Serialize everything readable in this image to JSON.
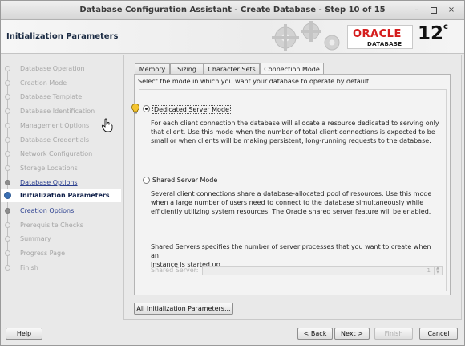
{
  "window": {
    "title": "Database Configuration Assistant - Create Database - Step 10 of 15",
    "minimize": "–",
    "close": "×"
  },
  "header": {
    "heading": "Initialization Parameters",
    "brand": "ORACLE",
    "brand_sub": "DATABASE",
    "version": "12",
    "version_sup": "c"
  },
  "steps": [
    {
      "label": "Database Operation",
      "state": "disabled"
    },
    {
      "label": "Creation Mode",
      "state": "disabled"
    },
    {
      "label": "Database Template",
      "state": "disabled"
    },
    {
      "label": "Database Identification",
      "state": "disabled"
    },
    {
      "label": "Management Options",
      "state": "disabled"
    },
    {
      "label": "Database Credentials",
      "state": "disabled"
    },
    {
      "label": "Network Configuration",
      "state": "disabled"
    },
    {
      "label": "Storage Locations",
      "state": "disabled"
    },
    {
      "label": "Database Options",
      "state": "link"
    },
    {
      "label": "Initialization Parameters",
      "state": "current"
    },
    {
      "label": "Creation Options",
      "state": "link"
    },
    {
      "label": "Prerequisite Checks",
      "state": "disabled"
    },
    {
      "label": "Summary",
      "state": "disabled"
    },
    {
      "label": "Progress Page",
      "state": "disabled"
    },
    {
      "label": "Finish",
      "state": "disabled"
    }
  ],
  "tabs": [
    {
      "label": "Memory"
    },
    {
      "label": "Sizing"
    },
    {
      "label": "Character Sets"
    },
    {
      "label": "Connection Mode",
      "active": true
    }
  ],
  "connection_mode": {
    "intro": "Select the mode in which you want your database to operate by default:",
    "dedicated": {
      "label": "Dedicated Server Mode",
      "selected": true,
      "desc": [
        "For each client connection the database will allocate a resource dedicated to serving only",
        "that client.  Use this mode when the number of total client connections is expected to be",
        "small or when clients will be making persistent, long-running requests to the database."
      ]
    },
    "shared": {
      "label": "Shared Server Mode",
      "selected": false,
      "desc": [
        "Several client connections share a database-allocated pool of resources.  Use this mode",
        "when a large number of users need to connect to the database simultaneously while",
        "efficiently utilizing system resources.  The Oracle shared server feature will be enabled."
      ],
      "servers_desc": [
        "Shared Servers specifies the number of server processes that you want to create when an",
        "instance is started up."
      ],
      "servers_label": "Shared Server:",
      "servers_value": "1"
    }
  },
  "all_params_button": "All Initialization Parameters...",
  "footer": {
    "help": "Help",
    "back": "< Back",
    "next": "Next >",
    "finish": "Finish",
    "cancel": "Cancel"
  }
}
